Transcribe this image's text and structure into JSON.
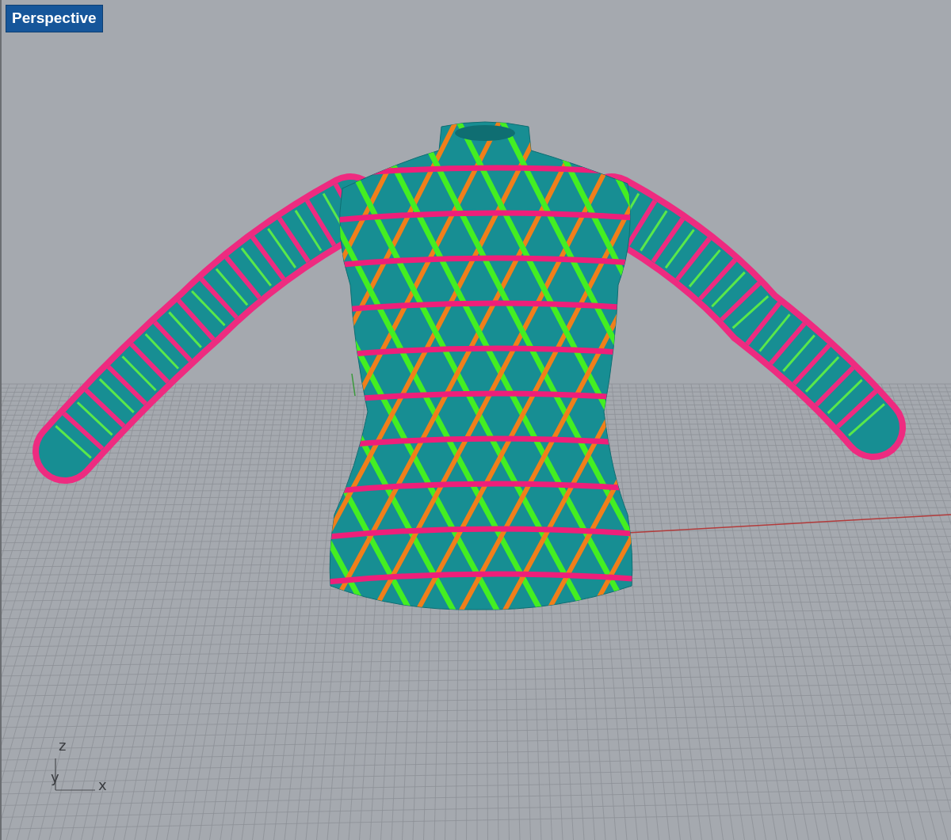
{
  "viewport": {
    "title": "Perspective"
  },
  "axis_widget": {
    "labels": [
      "z",
      "y",
      "x"
    ]
  }
}
